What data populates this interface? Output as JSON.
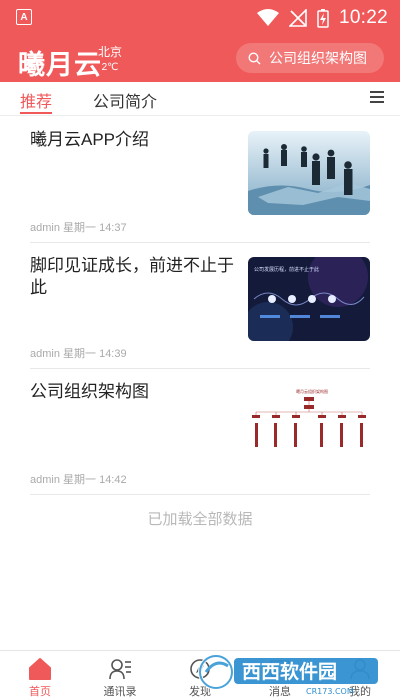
{
  "status_bar": {
    "time": "10:22",
    "app_icon_letter": "A"
  },
  "header": {
    "logo": "曦月云",
    "weather_city": "北京",
    "weather_temp": "2℃",
    "search_placeholder": "公司组织架构图"
  },
  "tabs": [
    {
      "label": "推荐",
      "active": true
    },
    {
      "label": "公司简介",
      "active": false
    }
  ],
  "articles": [
    {
      "title": "曦月云APP介绍",
      "meta": "admin 星期一 14:37",
      "thumb": "business-people-on-puzzle"
    },
    {
      "title": "脚印见证成长，前进不止于此",
      "meta": "admin 星期一 14:39",
      "thumb": "company-timeline",
      "thumb_text": "公司发展历程，前进不止于此"
    },
    {
      "title": "公司组织架构图",
      "meta": "admin 星期一 14:42",
      "thumb": "org-chart",
      "thumb_text": "曦月云组织架构图"
    }
  ],
  "load_all_text": "已加载全部数据",
  "bottom_nav": [
    {
      "label": "首页",
      "icon": "home-icon",
      "active": true
    },
    {
      "label": "通讯录",
      "icon": "contacts-icon",
      "active": false
    },
    {
      "label": "发现",
      "icon": "discover-icon",
      "active": false
    },
    {
      "label": "消息",
      "icon": "message-icon",
      "active": false
    },
    {
      "label": "我的",
      "icon": "profile-icon",
      "active": false
    }
  ],
  "watermark": {
    "brand": "西西软件园",
    "domain": "CR173.COM"
  },
  "colors": {
    "accent": "#f0595a",
    "text": "#222222",
    "muted": "#aaaaaa"
  }
}
